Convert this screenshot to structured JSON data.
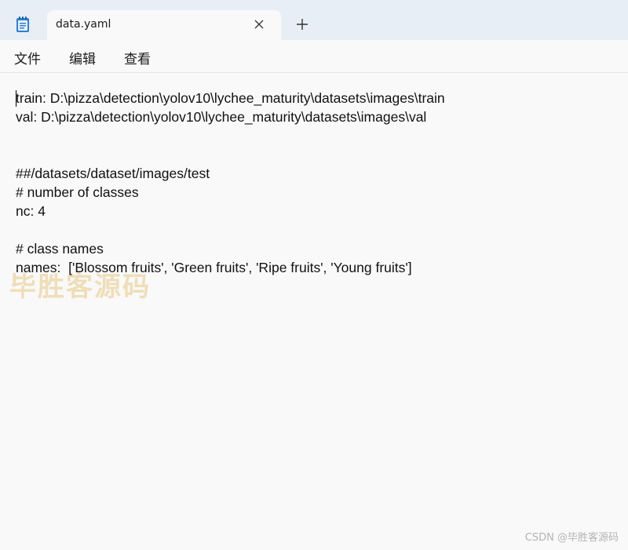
{
  "app": {
    "icon": "notepad-icon",
    "tab_title": "data.yaml",
    "close_icon": "close-icon",
    "new_tab_icon": "plus-icon"
  },
  "menu": {
    "items": [
      "文件",
      "编辑",
      "查看"
    ]
  },
  "editor": {
    "lines": [
      "train: D:\\pizza\\detection\\yolov10\\lychee_maturity\\datasets\\images\\train",
      "val: D:\\pizza\\detection\\yolov10\\lychee_maturity\\datasets\\images\\val",
      "",
      "",
      "##/datasets/dataset/images/test",
      "# number of classes",
      "nc: 4",
      "",
      "# class names",
      "names:  ['Blossom fruits', 'Green fruits', 'Ripe fruits', 'Young fruits']"
    ]
  },
  "watermarks": {
    "overlay": "毕胜客源码",
    "footer": "CSDN @毕胜客源码"
  }
}
